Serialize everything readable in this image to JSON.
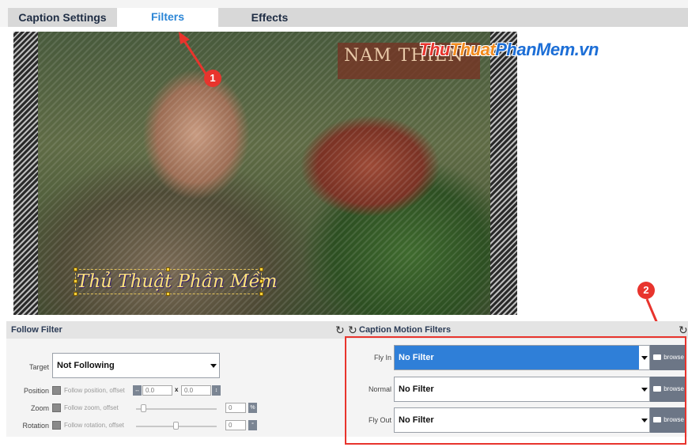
{
  "tabs": {
    "caption_settings": "Caption Settings",
    "filters": "Filters",
    "effects": "Effects"
  },
  "preview": {
    "sign_text": "NAM THIÊN",
    "caption_text": "Thủ Thuật Phần Mềm"
  },
  "watermark": {
    "part1": "Thu",
    "part2": "Thuat",
    "part3": "PhanMem.vn"
  },
  "markers": {
    "one": "1",
    "two": "2"
  },
  "follow_filter": {
    "title": "Follow Filter",
    "target_label": "Target",
    "target_value": "Not Following",
    "position_label": "Position",
    "position_text": "Follow position, offset",
    "position_x": "0.0",
    "position_y": "0.0",
    "zoom_label": "Zoom",
    "zoom_text": "Follow zoom, offset",
    "zoom_value": "0",
    "zoom_unit": "%",
    "rotation_label": "Rotation",
    "rotation_text": "Follow rotation, offset",
    "rotation_value": "0",
    "rotation_unit": "°",
    "x_sep": "x"
  },
  "motion_filters": {
    "title": "Caption Motion Filters",
    "rows": [
      {
        "label": "Fly In",
        "value": "No Filter",
        "browse": "browse"
      },
      {
        "label": "Normal",
        "value": "No Filter",
        "browse": "browse"
      },
      {
        "label": "Fly Out",
        "value": "No Filter",
        "browse": "browse"
      }
    ]
  },
  "icons": {
    "refresh": "↻"
  },
  "colors": {
    "accent": "#2c86d6",
    "selected_row": "#2f7fd8",
    "annotation": "#e8342d",
    "browse_button": "#6c7686"
  }
}
